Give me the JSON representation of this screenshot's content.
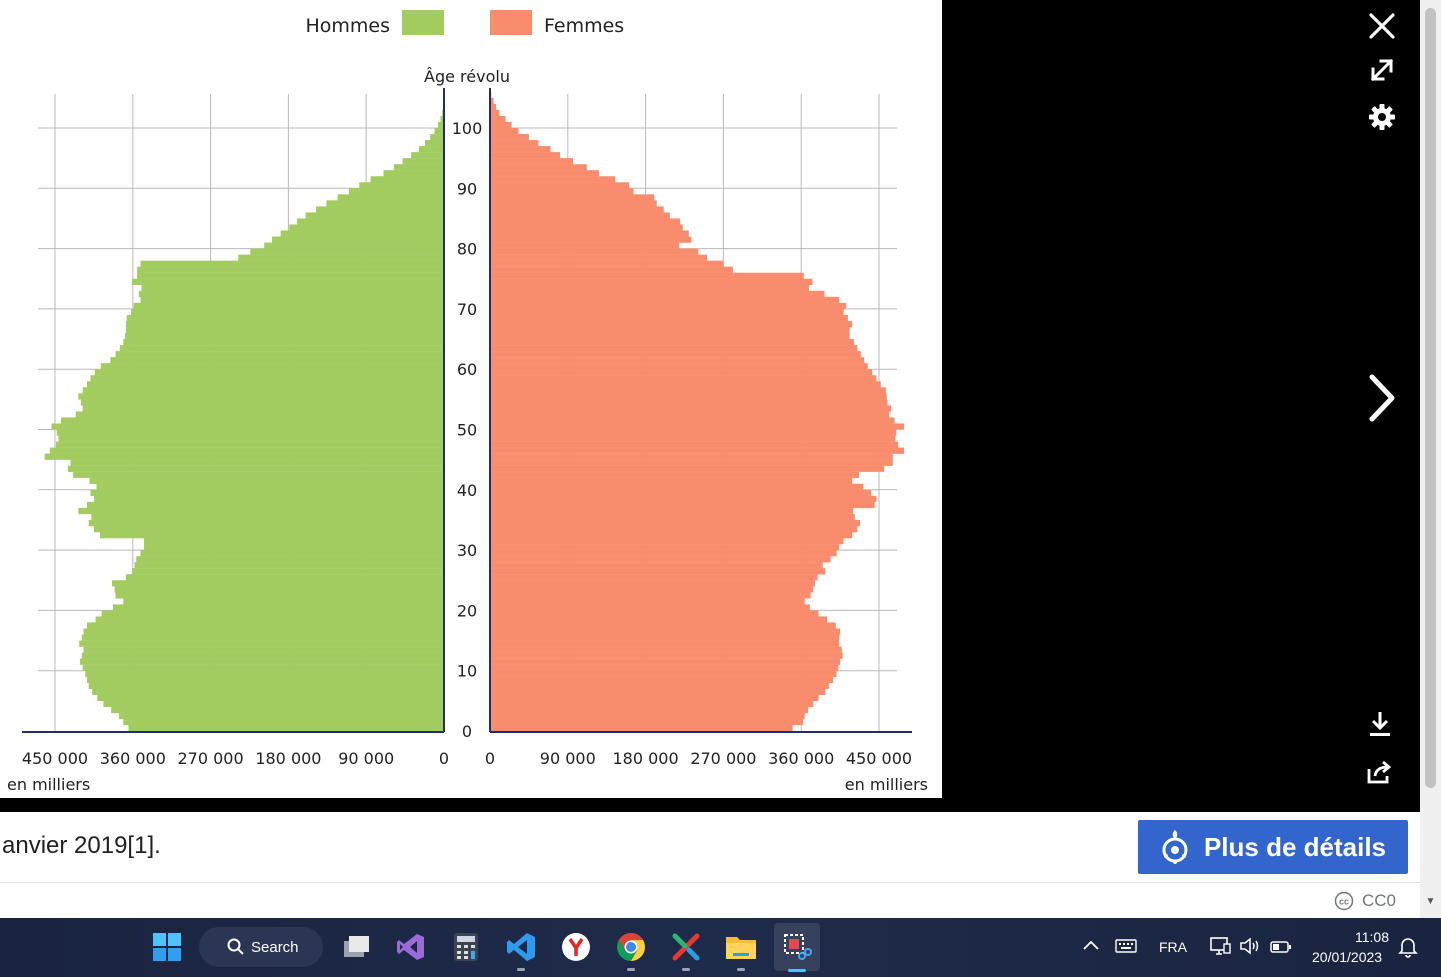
{
  "chart_data": {
    "type": "population-pyramid",
    "legend": [
      "Hommes",
      "Femmes"
    ],
    "colors": {
      "hommes": "#a2cc5f",
      "femmes": "#fa8c6e",
      "axis": "#1f2e6b"
    },
    "y_axis_title": "Âge révolu",
    "age_ticks": [
      "0",
      "10",
      "20",
      "30",
      "40",
      "50",
      "60",
      "70",
      "80",
      "90",
      "100"
    ],
    "x_ticks_left": [
      "450 000",
      "360 000",
      "270 000",
      "180 000",
      "90 000",
      "0"
    ],
    "x_ticks_right": [
      "0",
      "90 000",
      "180 000",
      "270 000",
      "360 000",
      "450 000"
    ],
    "unit_left": "en milliers",
    "unit_right": "en milliers",
    "xlim": [
      0,
      480000
    ],
    "age_range": [
      0,
      105
    ],
    "hommes": [
      365000,
      371000,
      376000,
      385000,
      394000,
      401000,
      407000,
      411000,
      413000,
      415000,
      418000,
      421000,
      419000,
      417000,
      422000,
      419000,
      417000,
      413000,
      403000,
      396000,
      383000,
      371000,
      380000,
      381000,
      384000,
      368000,
      361000,
      358000,
      356000,
      351000,
      347000,
      347000,
      398000,
      405000,
      411000,
      408000,
      423000,
      413000,
      405000,
      409000,
      402000,
      410000,
      429000,
      435000,
      432000,
      462000,
      456000,
      449000,
      446000,
      448000,
      454000,
      443000,
      426000,
      418000,
      420000,
      423000,
      418000,
      413000,
      409000,
      404000,
      397000,
      386000,
      380000,
      375000,
      371000,
      369000,
      368000,
      368000,
      367000,
      362000,
      359000,
      351000,
      353000,
      350000,
      361000,
      355000,
      355000,
      351000,
      238000,
      224000,
      208000,
      199000,
      189000,
      179000,
      170000,
      160000,
      148000,
      136000,
      123000,
      110000,
      98000,
      85000,
      70000,
      58000,
      48000,
      38000,
      29000,
      22000,
      16000,
      11000,
      7000,
      4000,
      2000,
      1000,
      500,
      200
    ],
    "femmes": [
      350000,
      362000,
      364000,
      368000,
      374000,
      380000,
      388000,
      392000,
      397000,
      401000,
      403000,
      405000,
      408000,
      407000,
      404000,
      404000,
      405000,
      400000,
      390000,
      380000,
      370000,
      364000,
      371000,
      374000,
      376000,
      379000,
      388000,
      385000,
      394000,
      401000,
      404000,
      409000,
      419000,
      425000,
      428000,
      422000,
      420000,
      445000,
      447000,
      441000,
      432000,
      419000,
      427000,
      456000,
      466000,
      466000,
      479000,
      472000,
      469000,
      470000,
      479000,
      468000,
      462000,
      464000,
      460000,
      459000,
      458000,
      452000,
      447000,
      442000,
      437000,
      433000,
      429000,
      425000,
      421000,
      416000,
      416000,
      419000,
      414000,
      409000,
      412000,
      404000,
      387000,
      369000,
      373000,
      363000,
      281000,
      270000,
      251000,
      241000,
      219000,
      233000,
      230000,
      223000,
      220000,
      208000,
      201000,
      193000,
      190000,
      166000,
      161000,
      145000,
      126000,
      112000,
      96000,
      81000,
      70000,
      56000,
      45000,
      33000,
      25000,
      18000,
      11000,
      7000,
      4000,
      1500
    ]
  },
  "viewer": {
    "controls": [
      "close-icon",
      "expand-icon",
      "gear-icon",
      "next-icon",
      "download-icon",
      "share-icon"
    ]
  },
  "caption": {
    "text": "anvier 2019[1].",
    "details_button": "Plus de détails"
  },
  "license": {
    "label": "CC0"
  },
  "taskbar": {
    "search_label": "Search",
    "language": "FRA",
    "time": "11:08",
    "date": "20/01/2023"
  }
}
